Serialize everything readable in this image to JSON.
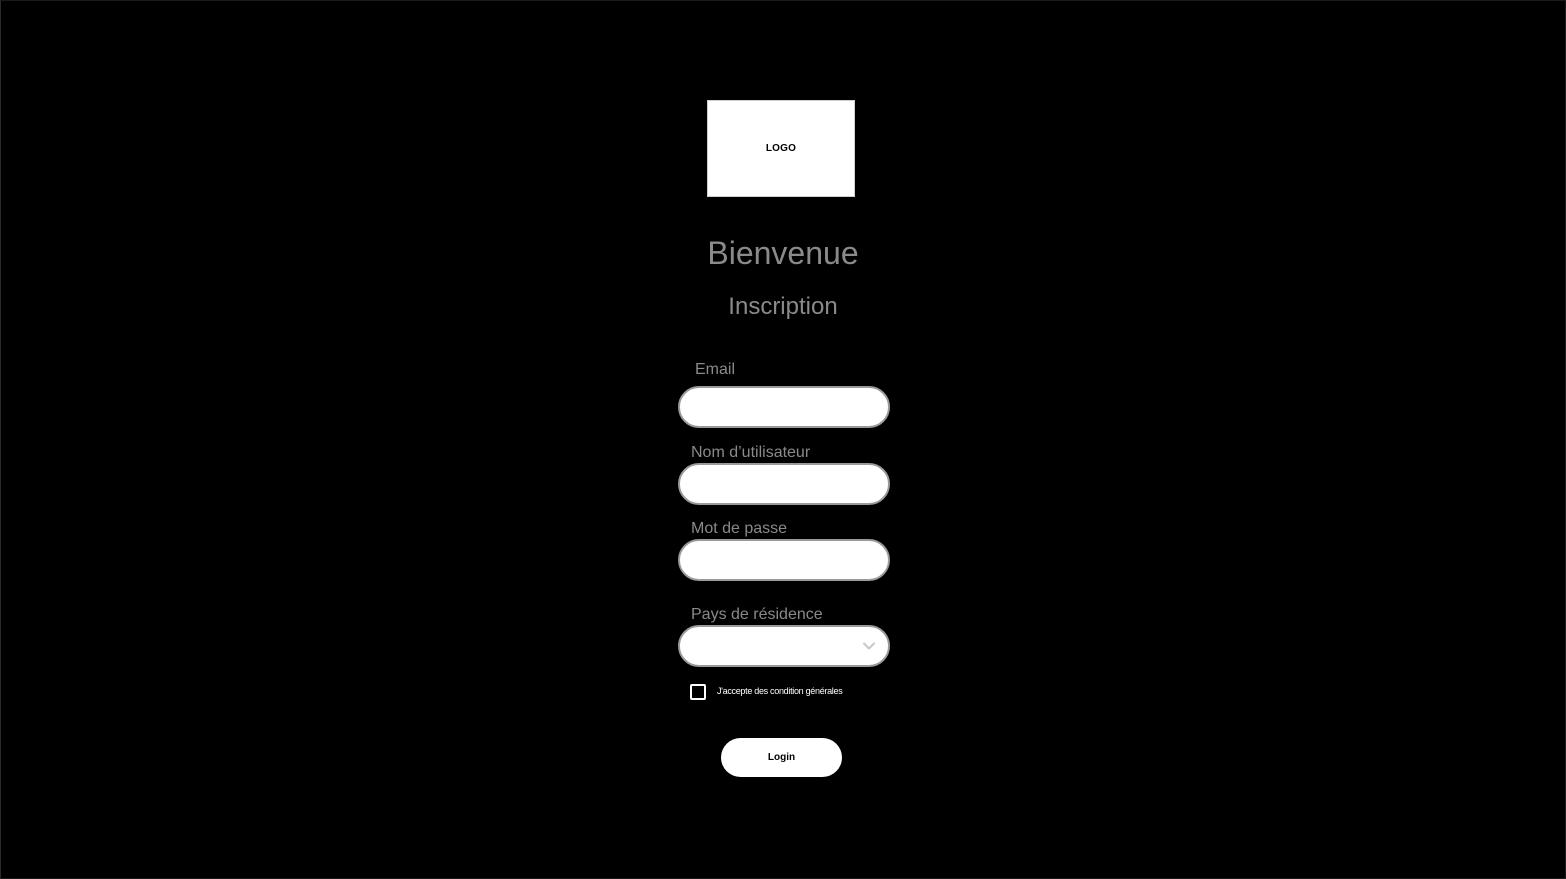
{
  "logo": {
    "text": "LOGO"
  },
  "header": {
    "title": "Bienvenue",
    "subtitle": "Inscription"
  },
  "form": {
    "email": {
      "label": "Email",
      "value": ""
    },
    "username": {
      "label": "Nom d’utilisateur",
      "value": ""
    },
    "password": {
      "label": "Mot de passe",
      "value": ""
    },
    "country": {
      "label": "Pays de résidence",
      "selected": ""
    },
    "terms": {
      "label": "J'accepte des condition générales",
      "checked": false
    },
    "submit_label": "Login"
  },
  "colors": {
    "background": "#000000",
    "label_text": "#8a8a8a",
    "field_fill": "#ffffff",
    "field_border": "#9a9a9a"
  }
}
